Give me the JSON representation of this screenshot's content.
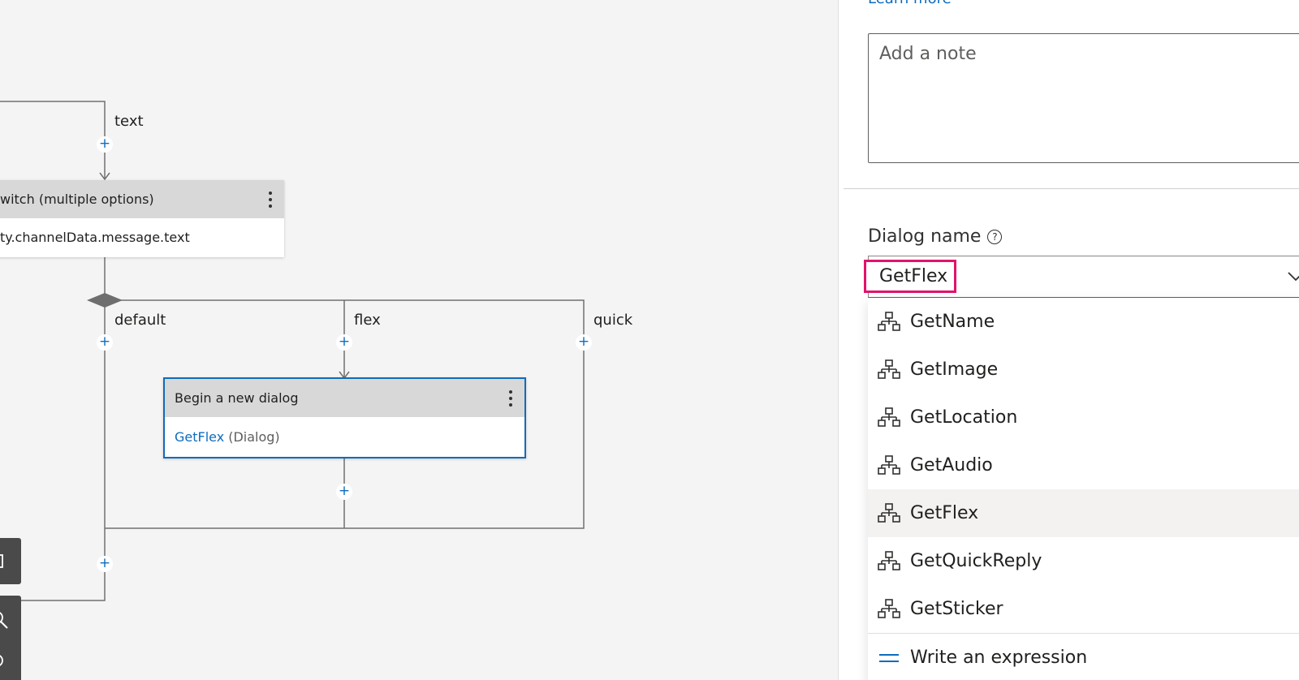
{
  "canvas": {
    "branch_labels": {
      "text": "text",
      "default": "default",
      "flex": "flex",
      "quick": "quick"
    },
    "switch_node": {
      "title": "witch (multiple options)",
      "condition": "ty.channelData.message.text"
    },
    "dialog_node": {
      "title": "Begin a new dialog",
      "dialog_link": "GetFlex",
      "dialog_suffix": "(Dialog)"
    },
    "plus_glyph": "+"
  },
  "panel": {
    "learn_more": "Learn more",
    "note_placeholder": "Add a note",
    "dialog_name_label": "Dialog name",
    "help_glyph": "?",
    "dialog_name_value": "GetFlex",
    "options": [
      "GetName",
      "GetImage",
      "GetLocation",
      "GetAudio",
      "GetFlex",
      "GetQuickReply",
      "GetSticker"
    ],
    "selected_option": "GetFlex",
    "write_expression": "Write an expression"
  },
  "colors": {
    "accent": "#0f6cbd",
    "highlight": "#e3126b",
    "selected_bg": "#f3f2f1"
  }
}
